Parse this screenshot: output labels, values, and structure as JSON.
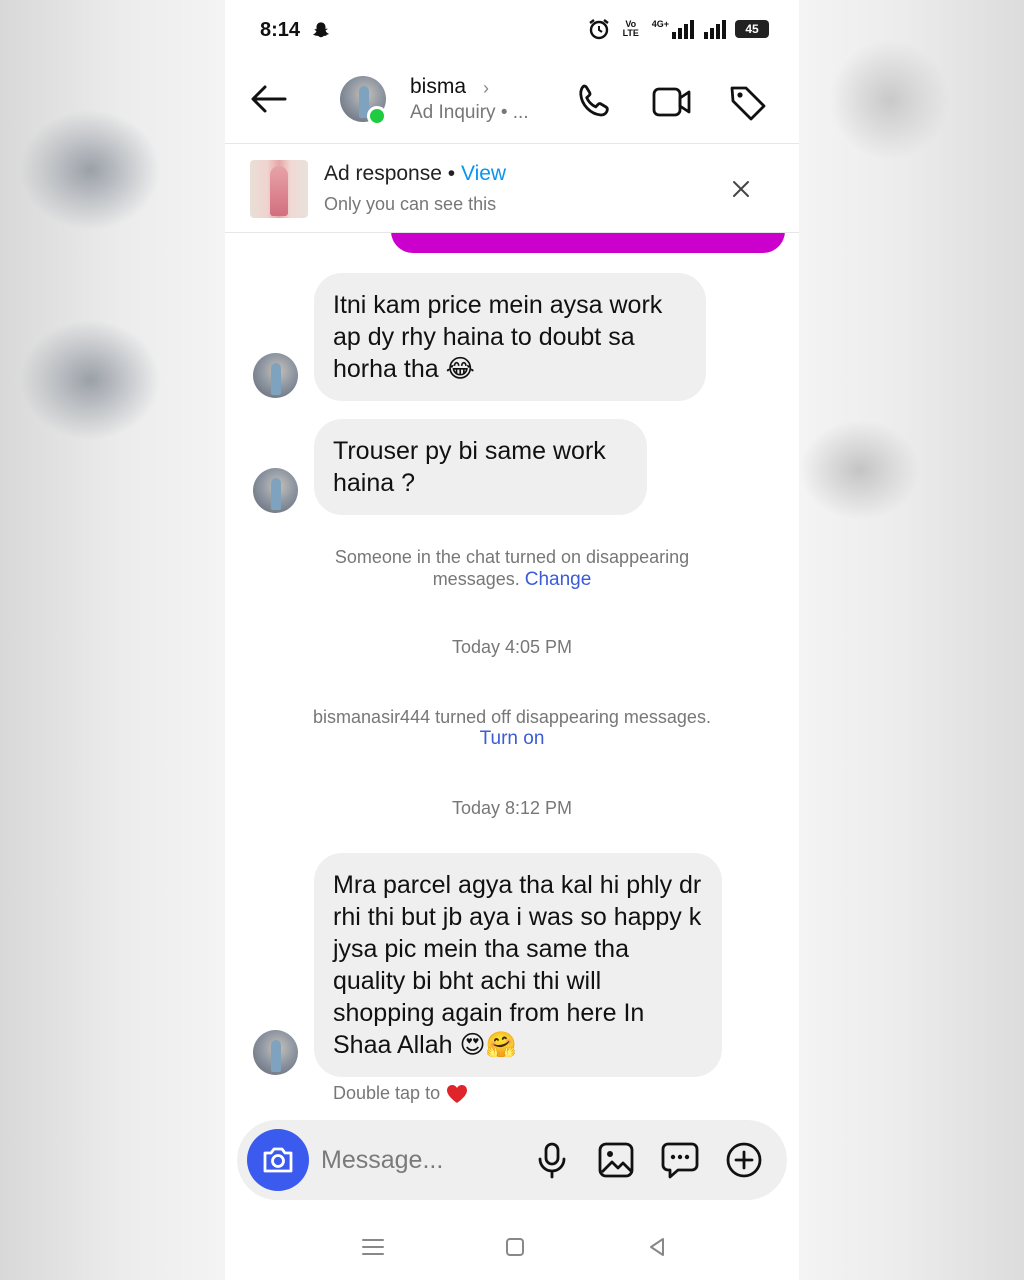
{
  "status_bar": {
    "time": "8:14",
    "network_label": "Vo LTE",
    "network_type": "4G+",
    "battery": "45",
    "icons": [
      "snapchat-icon",
      "alarm-icon",
      "signal-icon",
      "battery-icon"
    ]
  },
  "header": {
    "contact_name": "bisma",
    "contact_sub": "Ad Inquiry • ...",
    "online": true,
    "icons": [
      "back-arrow-icon",
      "phone-icon",
      "video-camera-icon",
      "tag-icon"
    ]
  },
  "ad_banner": {
    "title": "Ad response",
    "separator": " • ",
    "view_label": "View",
    "subtitle": "Only you can see this"
  },
  "messages": [
    {
      "sender": "bisma",
      "text": "Itni kam price mein aysa work ap dy rhy haina to doubt sa horha tha 😂"
    },
    {
      "sender": "bisma",
      "text": "Trouser py bi same work haina ?"
    },
    {
      "sender": "bisma",
      "text": "Mra parcel agya tha kal hi phly dr rhi thi but jb aya i was so happy k jysa pic mein tha same tha quality bi bht achi thi will shopping again from here In Shaa Allah 😍🤗"
    }
  ],
  "system_messages": {
    "disappearing_on": "Someone in the chat turned on disappearing messages.",
    "change_link": "Change",
    "timestamp_1": "Today 4:05 PM",
    "disappearing_off": "bismanasir444 turned off disappearing messages.",
    "turn_on_link": "Turn on",
    "timestamp_2": "Today 8:12 PM"
  },
  "reaction_hint": "Double tap to",
  "composer": {
    "placeholder": "Message...",
    "icons": [
      "camera-icon",
      "microphone-icon",
      "gallery-icon",
      "sticker-chat-icon",
      "add-icon"
    ]
  },
  "colors": {
    "accent_blue": "#3a5bee",
    "link_blue": "#0a95f1",
    "magenta": "#cc00cc",
    "online_green": "#1fcc3f",
    "bubble_gray": "#efefef"
  }
}
